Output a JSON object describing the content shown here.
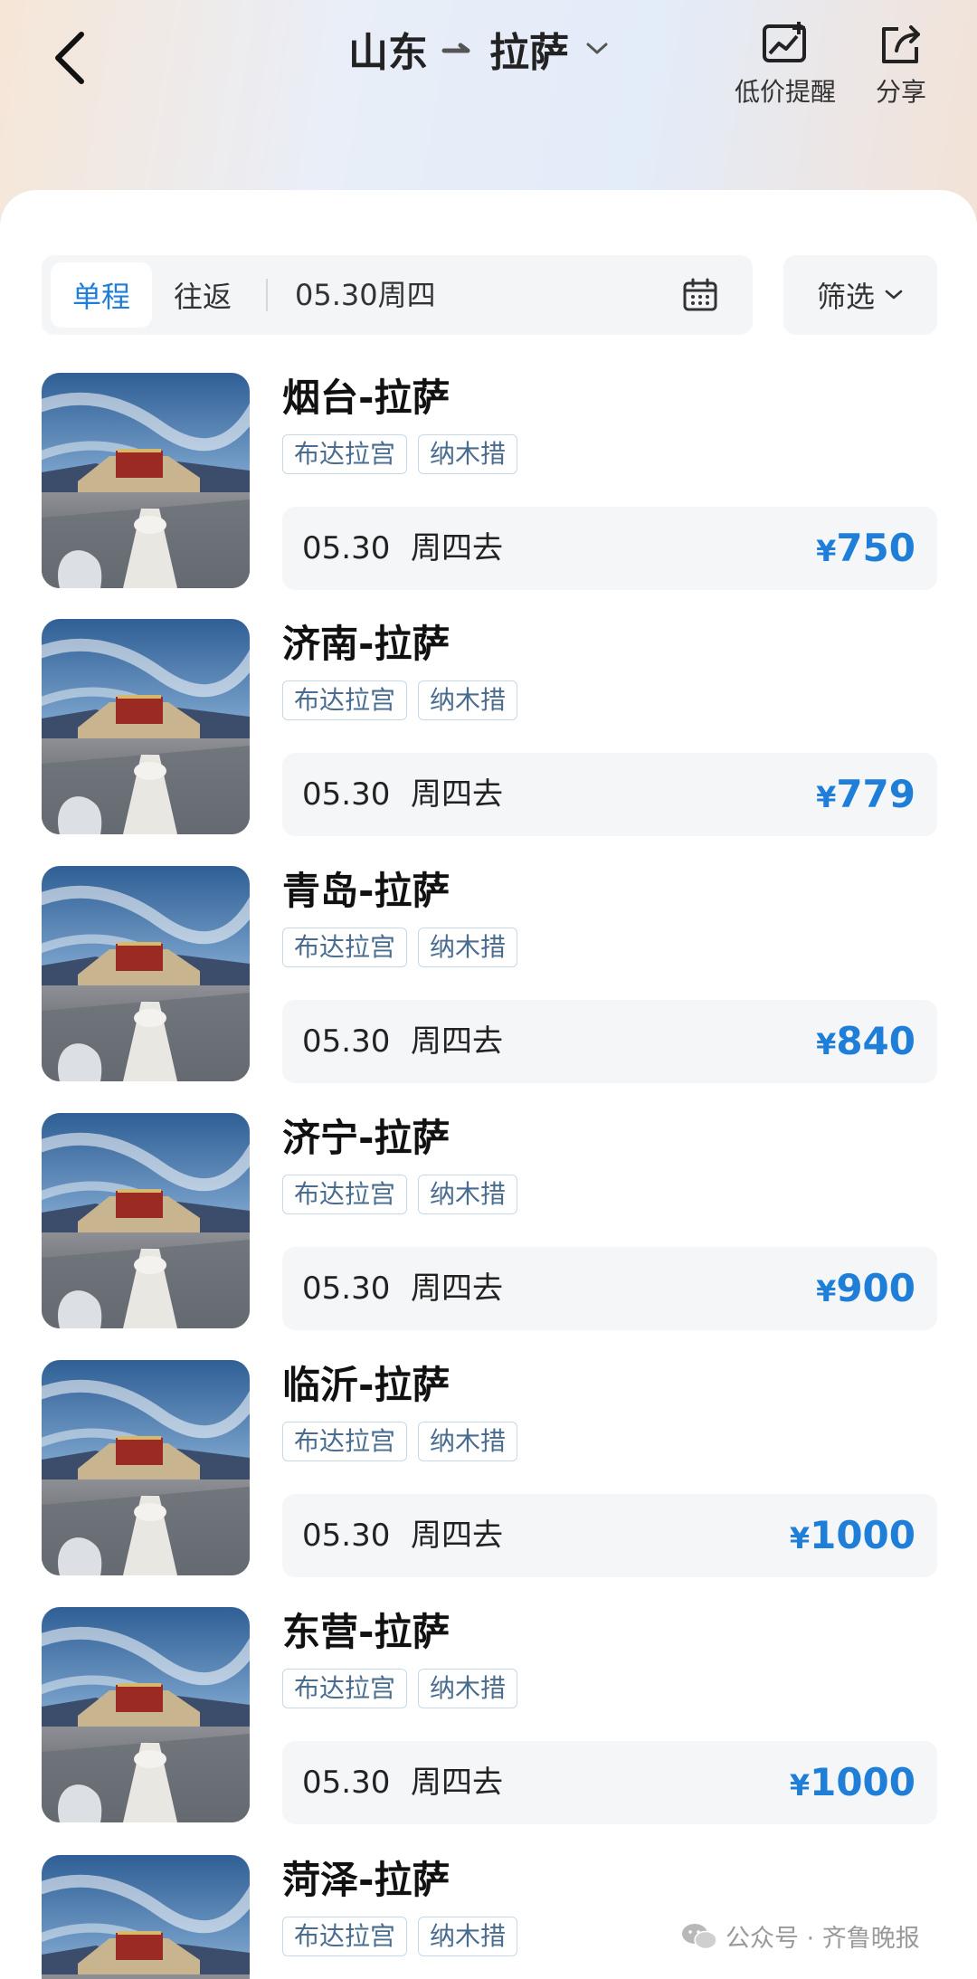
{
  "header": {
    "origin": "山东",
    "destination": "拉萨",
    "alert_label": "低价提醒",
    "share_label": "分享"
  },
  "search": {
    "tab_oneway": "单程",
    "tab_round": "往返",
    "date": "05.30周四",
    "filter_label": "筛选"
  },
  "routes": [
    {
      "name": "烟台-拉萨",
      "tags": [
        "布达拉宫",
        "纳木措"
      ],
      "date": "05.30",
      "day": "周四去",
      "currency": "¥",
      "price": "750"
    },
    {
      "name": "济南-拉萨",
      "tags": [
        "布达拉宫",
        "纳木措"
      ],
      "date": "05.30",
      "day": "周四去",
      "currency": "¥",
      "price": "779"
    },
    {
      "name": "青岛-拉萨",
      "tags": [
        "布达拉宫",
        "纳木措"
      ],
      "date": "05.30",
      "day": "周四去",
      "currency": "¥",
      "price": "840"
    },
    {
      "name": "济宁-拉萨",
      "tags": [
        "布达拉宫",
        "纳木措"
      ],
      "date": "05.30",
      "day": "周四去",
      "currency": "¥",
      "price": "900"
    },
    {
      "name": "临沂-拉萨",
      "tags": [
        "布达拉宫",
        "纳木措"
      ],
      "date": "05.30",
      "day": "周四去",
      "currency": "¥",
      "price": "1000"
    },
    {
      "name": "东营-拉萨",
      "tags": [
        "布达拉宫",
        "纳木措"
      ],
      "date": "05.30",
      "day": "周四去",
      "currency": "¥",
      "price": "1000"
    },
    {
      "name": "菏泽-拉萨",
      "tags": [
        "布达拉宫",
        "纳木措"
      ]
    }
  ],
  "watermark": "公众号 · 齐鲁晚报",
  "colors": {
    "accent": "#1f7fd8",
    "tag_text": "#4a6d8f",
    "card_bg": "#f5f6f8"
  }
}
